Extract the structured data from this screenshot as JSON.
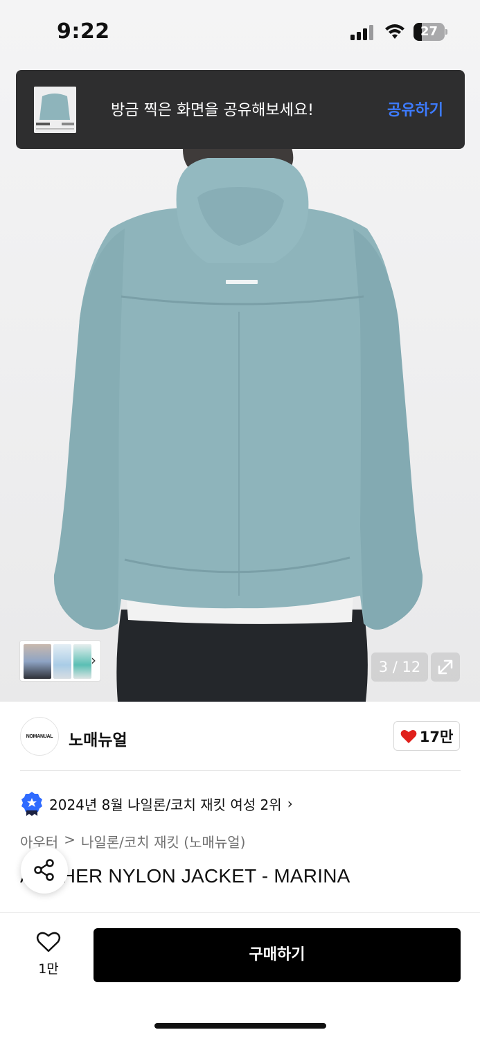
{
  "status_bar": {
    "time": "9:22",
    "battery": "27",
    "battery_level": 0.27,
    "icons": [
      "signal-icon",
      "wifi-icon",
      "battery-icon"
    ]
  },
  "toast": {
    "message": "방금 찍은 화면을 공유해보세요!",
    "action": "공유하기",
    "action_color": "#3d7bff"
  },
  "gallery": {
    "counter": "3 / 12",
    "expand_icon": "expand-icon",
    "thumbnail_more_icon": "chevron-right-icon"
  },
  "brand": {
    "logo_text": "NOMANUAL",
    "name": "노매뉴얼",
    "likes": "17만",
    "like_icon": "heart-filled-icon",
    "like_color": "#e0201b"
  },
  "ranking": {
    "text": "2024년 8월 나일론/코치 재킷 여성 2위",
    "badge_icon": "ranking-badge-icon",
    "badge_color": "#2f6bff"
  },
  "breadcrumb": {
    "items": [
      "아우터",
      "나일론/코치 재킷 (노매뉴얼)"
    ],
    "separator": ">"
  },
  "product": {
    "title": "ARCHER NYLON JACKET - MARINA"
  },
  "bottom_bar": {
    "wish_count": "1만",
    "buy_label": "구매하기"
  }
}
